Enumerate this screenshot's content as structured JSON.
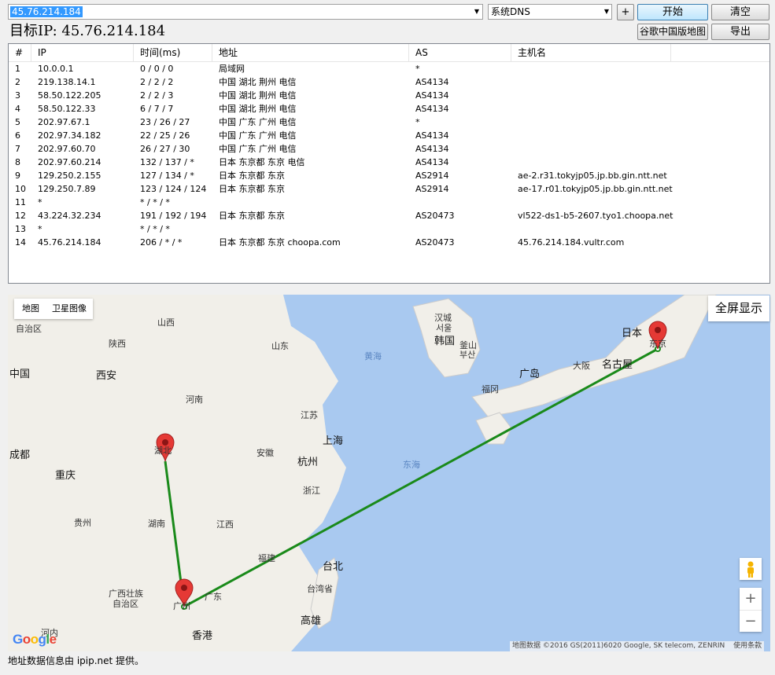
{
  "toolbar": {
    "target_value": "45.76.214.184",
    "dns_value": "系统DNS",
    "plus_label": "+",
    "start_label": "开始",
    "clear_label": "清空",
    "gmap_label": "谷歌中国版地图",
    "export_label": "导出"
  },
  "target_line": "目标IP: 45.76.214.184",
  "table": {
    "headers": [
      "#",
      "IP",
      "时间(ms)",
      "地址",
      "AS",
      "主机名"
    ],
    "rows": [
      [
        "1",
        "10.0.0.1",
        "0 / 0 / 0",
        "局域网",
        "*",
        ""
      ],
      [
        "2",
        "219.138.14.1",
        "2 / 2 / 2",
        "中国 湖北 荆州 电信",
        "AS4134",
        ""
      ],
      [
        "3",
        "58.50.122.205",
        "2 / 2 / 3",
        "中国 湖北 荆州 电信",
        "AS4134",
        ""
      ],
      [
        "4",
        "58.50.122.33",
        "6 / 7 / 7",
        "中国 湖北 荆州 电信",
        "AS4134",
        ""
      ],
      [
        "5",
        "202.97.67.1",
        "23 / 26 / 27",
        "中国 广东 广州 电信",
        "*",
        ""
      ],
      [
        "6",
        "202.97.34.182",
        "22 / 25 / 26",
        "中国 广东 广州 电信",
        "AS4134",
        ""
      ],
      [
        "7",
        "202.97.60.70",
        "26 / 27 / 30",
        "中国 广东 广州 电信",
        "AS4134",
        ""
      ],
      [
        "8",
        "202.97.60.214",
        "132 / 137 / *",
        "日本 东京都 东京 电信",
        "AS4134",
        ""
      ],
      [
        "9",
        "129.250.2.155",
        "127 / 134 / *",
        "日本 东京都 东京",
        "AS2914",
        "ae-2.r31.tokyjp05.jp.bb.gin.ntt.net"
      ],
      [
        "10",
        "129.250.7.89",
        "123 / 124 / 124",
        "日本 东京都 东京",
        "AS2914",
        "ae-17.r01.tokyjp05.jp.bb.gin.ntt.net"
      ],
      [
        "11",
        "*",
        "* / * / *",
        "",
        "",
        ""
      ],
      [
        "12",
        "43.224.32.234",
        "191 / 192 / 194",
        "日本 东京都 东京",
        "AS20473",
        "vl522-ds1-b5-2607.tyo1.choopa.net"
      ],
      [
        "13",
        "*",
        "* / * / *",
        "",
        "",
        ""
      ],
      [
        "14",
        "45.76.214.184",
        "206 / * / *",
        "日本 东京都 东京 choopa.com",
        "AS20473",
        "45.76.214.184.vultr.com"
      ]
    ]
  },
  "map": {
    "type_map": "地图",
    "type_satellite": "卫星图像",
    "fullscreen_label": "全屏显示",
    "zoom_in": "+",
    "zoom_out": "−",
    "attribution": "地图数据 ©2016 GS(2011)6020 Google, SK telecom, ZENRIN",
    "terms": "使用条款",
    "logo": "Google",
    "route_color": "#1a8a1a",
    "marker_color": "#e53935",
    "water_color": "#a9c9f0",
    "labels": [
      "山西",
      "自治区",
      "陕西",
      "山东",
      "西安",
      "河南",
      "江苏",
      "上海",
      "安徽",
      "杭州",
      "成都",
      "重庆",
      "湖南",
      "浙江",
      "江西",
      "贵州",
      "福建",
      "广西壮族",
      "自治区",
      "台北",
      "台湾省",
      "高雄",
      "香港",
      "河内",
      "汉城",
      "서울",
      "韩国",
      "釜山",
      "부산",
      "日本",
      "东京",
      "名古屋",
      "大阪",
      "广岛",
      "福冈",
      "黄海",
      "东海",
      "中国",
      "广州",
      "广东",
      "湖北"
    ]
  },
  "footer_note": "地址数据信息由 ipip.net 提供。"
}
